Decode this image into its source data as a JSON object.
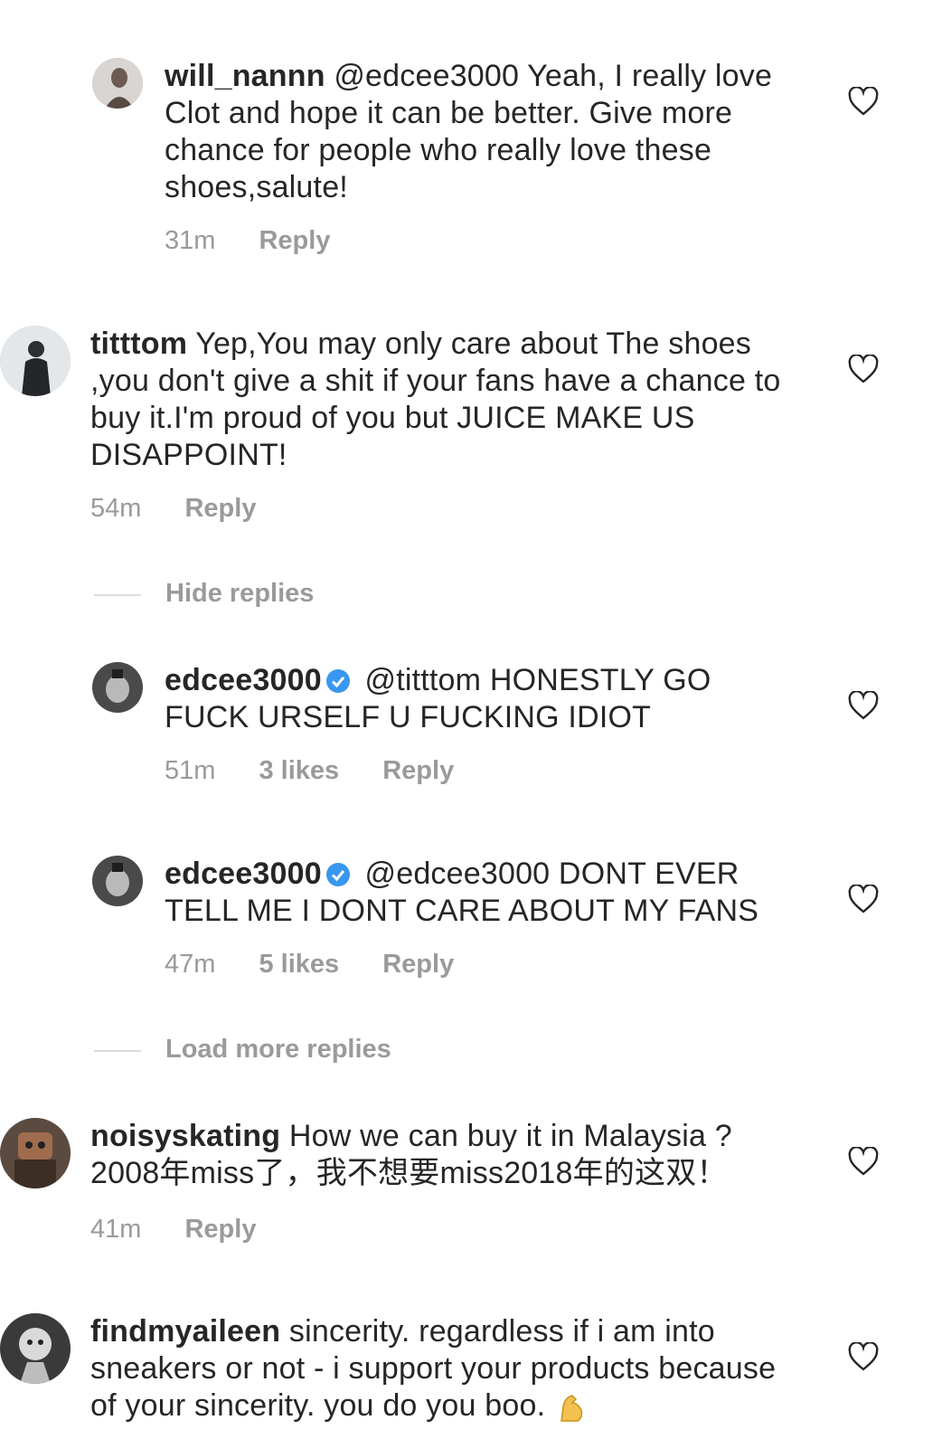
{
  "comments": [
    {
      "username": "will_nannn",
      "text": "@edcee3000 Yeah,  I really love Clot and hope it can be better. Give more chance for people who really love these shoes,salute!",
      "time": "31m",
      "reply": "Reply"
    },
    {
      "username": "titttom",
      "text": "Yep,You may only care about The shoes ,you don't give a shit  if your fans have a chance to buy it.I'm proud of you but JUICE MAKE US DISAPPOINT!",
      "time": "54m",
      "reply": "Reply"
    },
    {
      "username": "noisyskating",
      "text": "How we can buy it in Malaysia ? 2008年miss了，我不想要miss2018年的这双！",
      "time": "41m",
      "reply": "Reply"
    },
    {
      "username": "findmyaileen",
      "text": "sincerity.  regardless if i am into sneakers or not - i support your products because of your sincerity.  you do you boo."
    }
  ],
  "replies": [
    {
      "username": "edcee3000",
      "text": "@titttom HONESTLY GO FUCK URSELF U FUCKING IDIOT",
      "time": "51m",
      "likes": "3 likes",
      "reply": "Reply"
    },
    {
      "username": "edcee3000",
      "text": "@edcee3000 DONT EVER TELL ME I DONT CARE ABOUT MY FANS",
      "time": "47m",
      "likes": "5 likes",
      "reply": "Reply"
    }
  ],
  "threads": {
    "hide_replies": "Hide replies",
    "load_more": "Load more replies"
  },
  "icons": {
    "like": "heart-outline-icon",
    "verified": "verified-badge-icon",
    "emoji": "flexed-biceps-emoji"
  },
  "colors": {
    "text": "#262626",
    "meta": "#9a9a9a",
    "verified": "#3897f0"
  }
}
